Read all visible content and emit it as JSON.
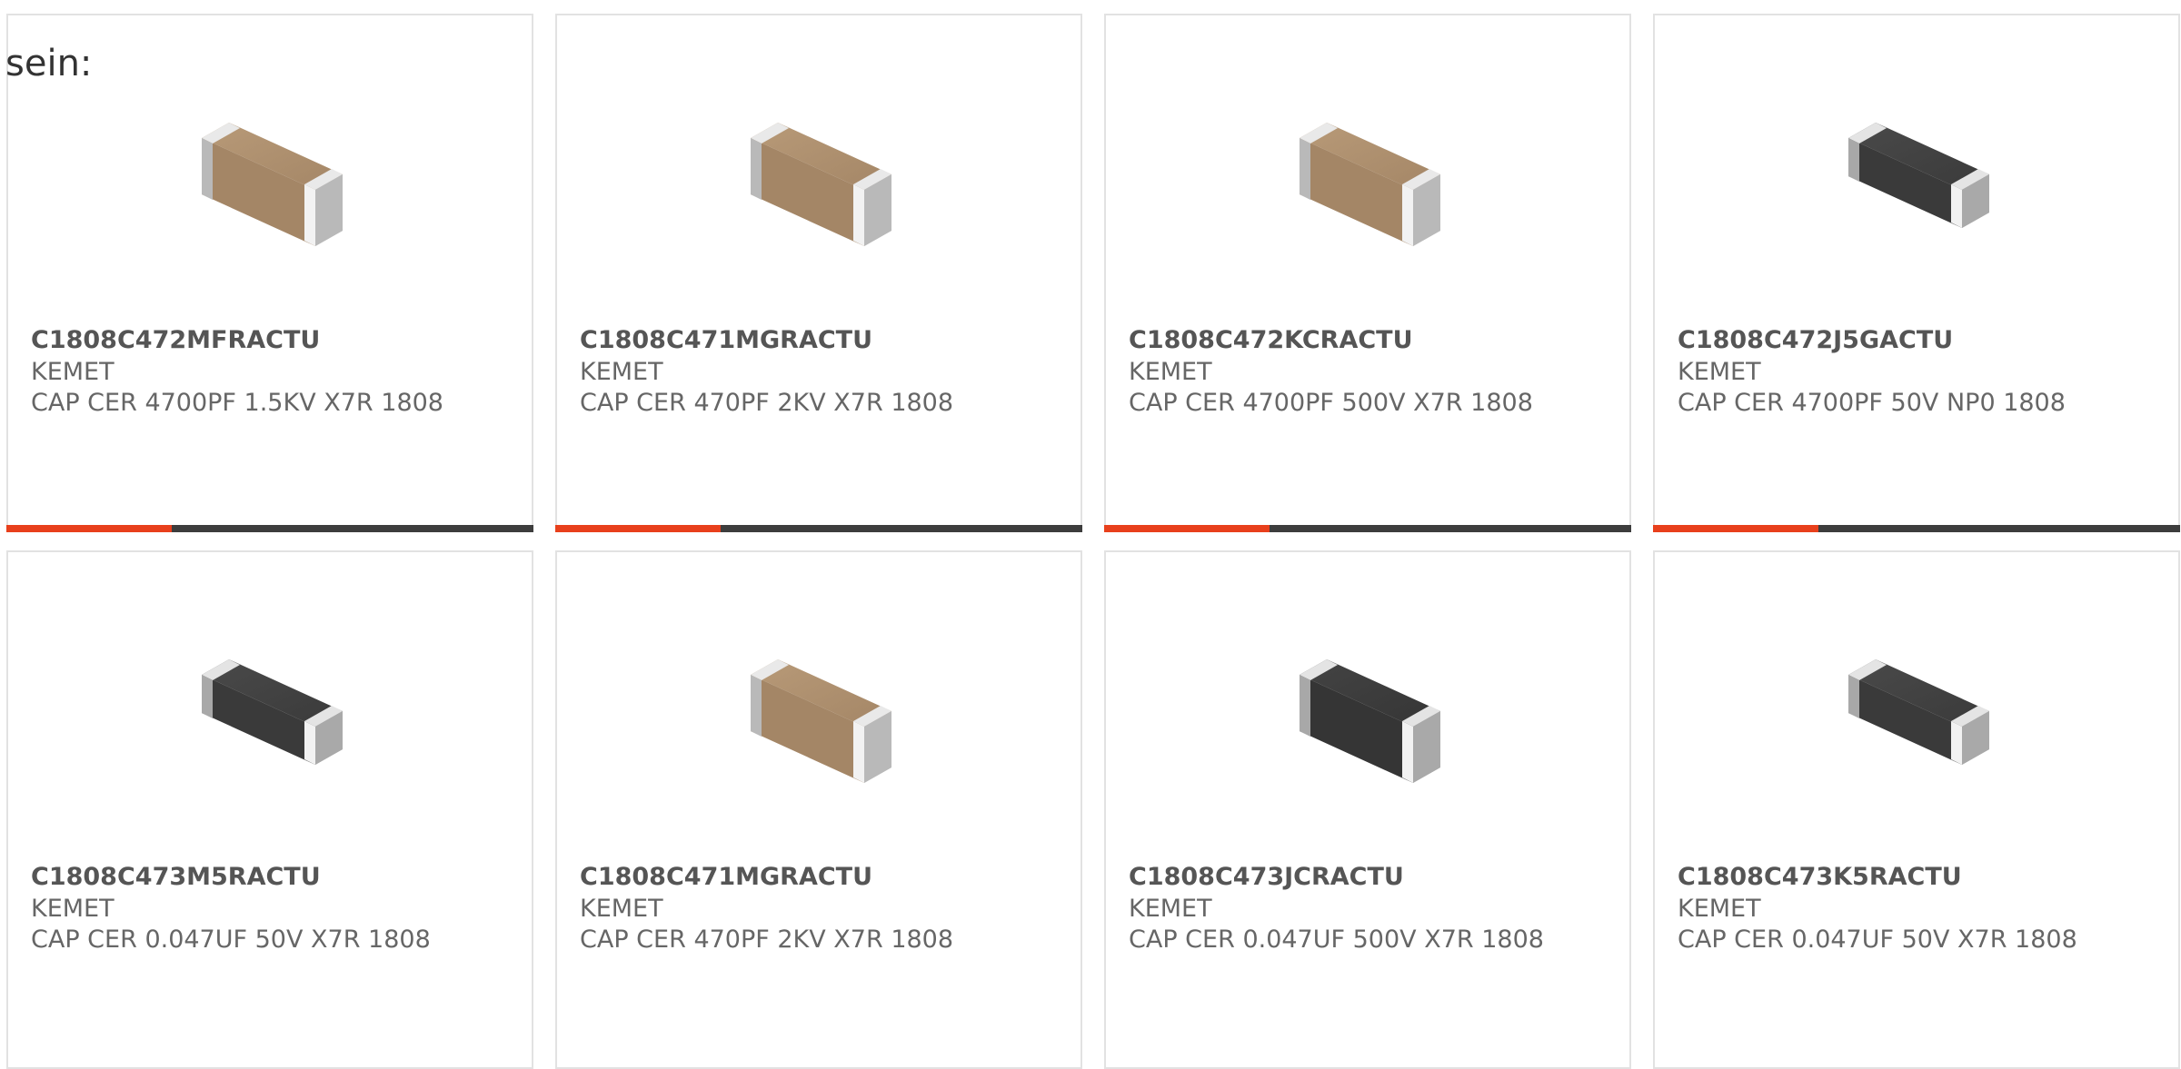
{
  "intro_text": "sein:",
  "colors": {
    "accent": "#e8401c",
    "bar": "#3d3d3d",
    "border": "#e2e2e2"
  },
  "products": [
    {
      "part": "C1808C472MFRACTU",
      "maker": "KEMET",
      "desc": "CAP CER 4700PF 1.5KV X7R 1808",
      "body": "tan",
      "icon": "capacitor-chip-icon"
    },
    {
      "part": "C1808C471MGRACTU",
      "maker": "KEMET",
      "desc": "CAP CER 470PF 2KV X7R 1808",
      "body": "tan",
      "icon": "capacitor-chip-icon"
    },
    {
      "part": "C1808C472KCRACTU",
      "maker": "KEMET",
      "desc": "CAP CER 4700PF 500V X7R 1808",
      "body": "tan",
      "icon": "capacitor-chip-icon"
    },
    {
      "part": "C1808C472J5GACTU",
      "maker": "KEMET",
      "desc": "CAP CER 4700PF 50V NP0 1808",
      "body": "dark",
      "icon": "capacitor-chip-icon"
    },
    {
      "part": "C1808C473M5RACTU",
      "maker": "KEMET",
      "desc": "CAP CER 0.047UF 50V X7R 1808",
      "body": "dark",
      "icon": "capacitor-chip-icon"
    },
    {
      "part": "C1808C471MGRACTU",
      "maker": "KEMET",
      "desc": "CAP CER 470PF 2KV X7R 1808",
      "body": "tan",
      "icon": "capacitor-chip-icon"
    },
    {
      "part": "C1808C473JCRACTU",
      "maker": "KEMET",
      "desc": "CAP CER 0.047UF 500V X7R 1808",
      "body": "dark-tall",
      "icon": "capacitor-chip-icon"
    },
    {
      "part": "C1808C473K5RACTU",
      "maker": "KEMET",
      "desc": "CAP CER 0.047UF 50V X7R 1808",
      "body": "dark",
      "icon": "capacitor-chip-icon"
    }
  ]
}
